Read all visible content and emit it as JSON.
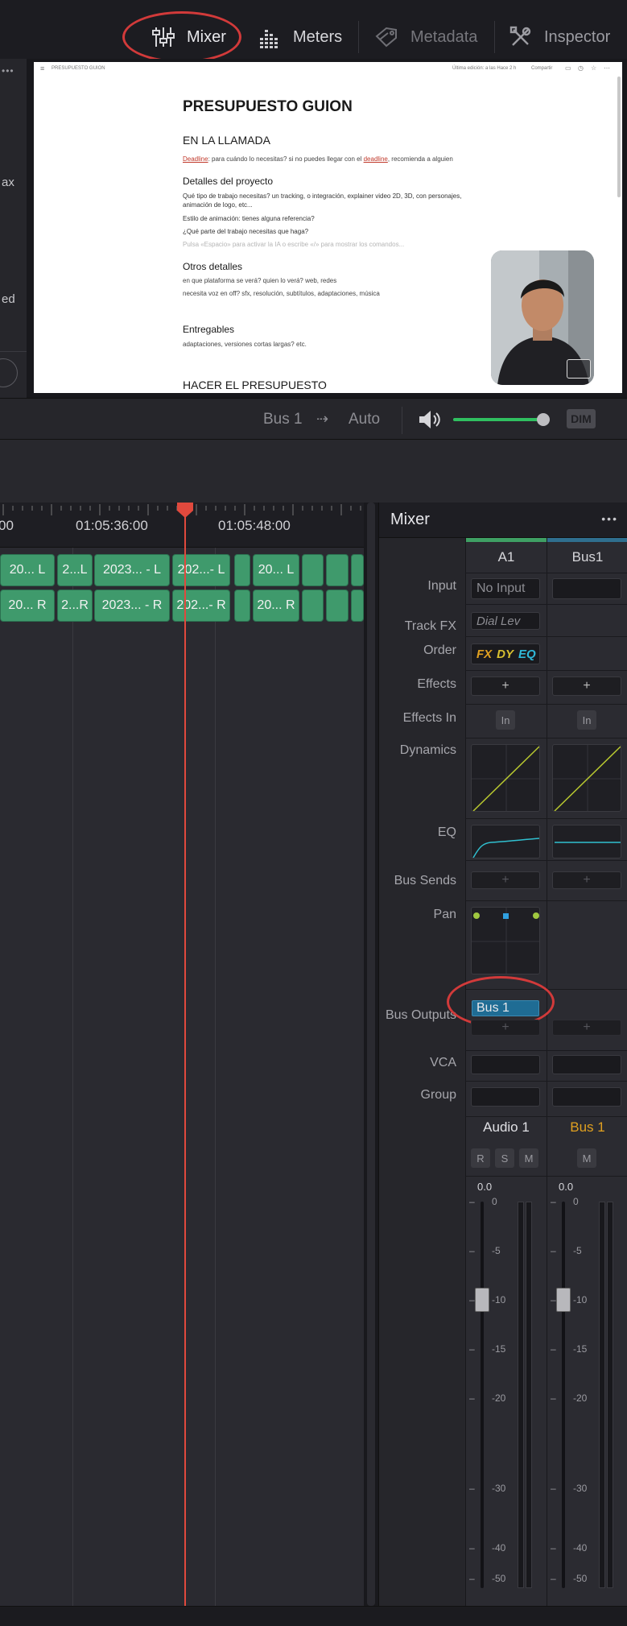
{
  "toolbar": {
    "mixer": "Mixer",
    "meters": "Meters",
    "metadata": "Metadata",
    "inspector": "Inspector"
  },
  "viewer": {
    "left_panel_fragments": [
      "ax",
      "ed"
    ],
    "doc": {
      "breadcrumb": "PRESUPUESTO GUION",
      "top_right": "Última edición: a las Hace 2 h",
      "share": "Compartir",
      "title": "PRESUPUESTO GUION",
      "section1": "EN LA LLAMADA",
      "deadline_line": {
        "a": "Deadline",
        "b": ": para cuándo lo necesitas? si no puedes llegar con el ",
        "c": "deadline",
        "d": ", recomienda a alguien"
      },
      "section2": "Detalles del proyecto",
      "p2a": "Qué tipo de trabajo necesitas? un tracking, o integración, explainer video 2D, 3D, con personajes, animación de logo, etc...",
      "p2b": "Estilo de animación: tienes alguna referencia?",
      "p2c": "¿Qué parte del trabajo necesitas que haga?",
      "p2d": "Pulsa «Espacio» para activar la IA o escribe «/» para mostrar los comandos...",
      "section3": "Otros detalles",
      "p3a": "en que plataforma se verá? quien lo verá? web, redes",
      "p3b": "necesita voz en off? sfx, resolución, subtítulos, adaptaciones, música",
      "section4": "Entregables",
      "p4a": "adaptaciones, versiones cortas largas? etc.",
      "section5": "HACER EL PRESUPUESTO"
    }
  },
  "transport": {
    "bus": "Bus 1",
    "arrow": "⇢",
    "auto": "Auto",
    "dim": "DIM",
    "volume_level": 0.93
  },
  "timeline": {
    "timecodes": [
      "00",
      "01:05:36:00",
      "01:05:48:00"
    ],
    "track1_clips": [
      "20... L",
      "2...L",
      "2023... - L",
      "202...- L",
      "",
      "20... L",
      "",
      "",
      ""
    ],
    "track2_clips": [
      "20... R",
      "2...R",
      "2023... - R",
      "202...- R",
      "",
      "20... R",
      "",
      "",
      ""
    ]
  },
  "mixer": {
    "title": "Mixer",
    "more": "•••",
    "strips": [
      "A1",
      "Bus1"
    ],
    "labels": {
      "input": "Input",
      "track_fx": "Track FX",
      "order": "Order",
      "effects": "Effects",
      "effects_in": "Effects In",
      "dynamics": "Dynamics",
      "eq": "EQ",
      "bus_sends": "Bus Sends",
      "pan": "Pan",
      "bus_outputs": "Bus Outputs",
      "vca": "VCA",
      "group": "Group"
    },
    "a1": {
      "input": "No Input",
      "track_fx": "Dial Lev",
      "order": [
        "FX",
        "DY",
        "EQ"
      ],
      "effects_plus": "+",
      "effects_in": "In",
      "bus_sends_plus": "+",
      "bus_output": "Bus 1",
      "bus_output_plus": "+",
      "name": "Audio 1",
      "buttons": [
        "R",
        "S",
        "M"
      ],
      "level": "0.0",
      "fader_db": -10
    },
    "bus1": {
      "effects_plus": "+",
      "effects_in": "In",
      "bus_sends_plus": "+",
      "bus_output_plus": "+",
      "name": "Bus 1",
      "buttons": [
        "M"
      ],
      "level": "0.0",
      "fader_db": -10
    },
    "scale": [
      "0",
      "-5",
      "-10",
      "-15",
      "-20",
      "-30",
      "-40",
      "-50"
    ],
    "colors": {
      "a1_accent": "#3fa064",
      "bus_accent": "#2f6f8f",
      "bus_name": "#e0a020",
      "highlight": "#d23a3a"
    }
  }
}
